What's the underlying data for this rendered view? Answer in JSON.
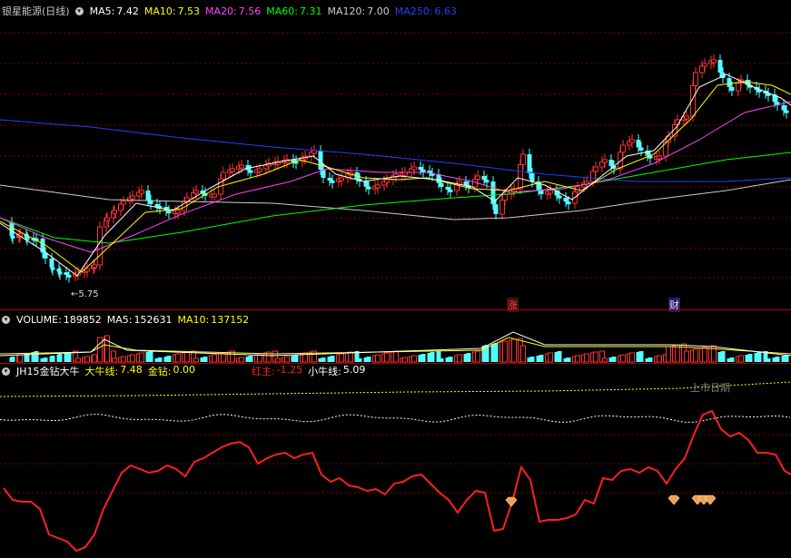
{
  "main": {
    "title": "银星能源(日线)",
    "ma5": {
      "label": "MA5:",
      "value": "7.42",
      "color": "#ffffff"
    },
    "ma10": {
      "label": "MA10:",
      "value": "7.53",
      "color": "#ffff00"
    },
    "ma20": {
      "label": "MA20:",
      "value": "7.56",
      "color": "#ff44ff"
    },
    "ma60": {
      "label": "MA60:",
      "value": "7.31",
      "color": "#00ff00"
    },
    "ma120": {
      "label": "MA120:",
      "value": "7.00",
      "color": "#cccccc"
    },
    "ma250": {
      "label": "MA250:",
      "value": "6.63",
      "color": "#2040ff"
    },
    "low_marker": "←5.75",
    "event_zhang": "涨",
    "event_cai": "财"
  },
  "volume": {
    "label": "VOLUME:",
    "value": "189852",
    "ma5_label": "MA5:",
    "ma5_value": "152631",
    "ma10_label": "MA10:",
    "ma10_value": "137152"
  },
  "indicator": {
    "name": "JH15金钻大牛",
    "daniu_label": "大牛线:",
    "daniu_value": "7.48",
    "jinzuan_label": "金钻:",
    "jinzuan_value": "0.00",
    "hongzhu_label": "红主:",
    "hongzhu_value": "-1.25",
    "xiaoniu_label": "小牛线:",
    "xiaoniu_value": "5.09",
    "listing_label": "上市日期"
  },
  "colors": {
    "up": "#ff3232",
    "down": "#54ffff",
    "grid": "#8b0000",
    "red_line": "#ff2020",
    "diamond": "#f0a050"
  }
}
